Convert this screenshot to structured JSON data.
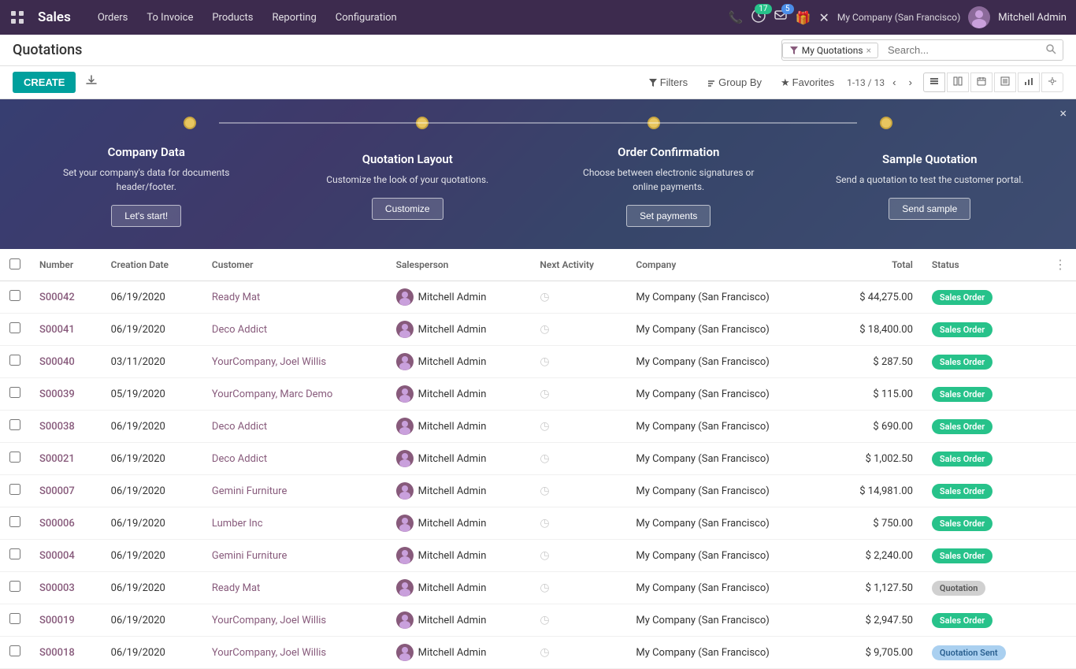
{
  "app": {
    "icon": "grid",
    "name": "Sales"
  },
  "nav": {
    "links": [
      "Orders",
      "To Invoice",
      "Products",
      "Reporting",
      "Configuration"
    ]
  },
  "topbar": {
    "phone_icon": "📞",
    "activity_badge": "17",
    "message_badge": "5",
    "gift_icon": "🎁",
    "close_icon": "✕",
    "company": "My Company (San Francisco)",
    "user_name": "Mitchell Admin"
  },
  "page": {
    "title": "Quotations",
    "search_tag": "My Quotations",
    "search_placeholder": "Search..."
  },
  "toolbar": {
    "create_label": "CREATE",
    "filters_label": "Filters",
    "group_by_label": "Group By",
    "favorites_label": "Favorites",
    "pagination": "1-13 / 13"
  },
  "banner": {
    "close": "×",
    "steps": [
      {
        "title": "Company Data",
        "description": "Set your company's data for documents header/footer.",
        "button": "Let's start!"
      },
      {
        "title": "Quotation Layout",
        "description": "Customize the look of your quotations.",
        "button": "Customize"
      },
      {
        "title": "Order Confirmation",
        "description": "Choose between electronic signatures or online payments.",
        "button": "Set payments"
      },
      {
        "title": "Sample Quotation",
        "description": "Send a quotation to test the customer portal.",
        "button": "Send sample"
      }
    ]
  },
  "table": {
    "headers": [
      "Number",
      "Creation Date",
      "Customer",
      "Salesperson",
      "Next Activity",
      "Company",
      "Total",
      "Status"
    ],
    "rows": [
      {
        "number": "S00042",
        "date": "06/19/2020",
        "customer": "Ready Mat",
        "salesperson": "Mitchell Admin",
        "activity": "",
        "company": "My Company (San Francisco)",
        "total": "$ 44,275.00",
        "status": "Sales Order",
        "status_type": "sales"
      },
      {
        "number": "S00041",
        "date": "06/19/2020",
        "customer": "Deco Addict",
        "salesperson": "Mitchell Admin",
        "activity": "",
        "company": "My Company (San Francisco)",
        "total": "$ 18,400.00",
        "status": "Sales Order",
        "status_type": "sales"
      },
      {
        "number": "S00040",
        "date": "03/11/2020",
        "customer": "YourCompany, Joel Willis",
        "salesperson": "Mitchell Admin",
        "activity": "",
        "company": "My Company (San Francisco)",
        "total": "$ 287.50",
        "status": "Sales Order",
        "status_type": "sales"
      },
      {
        "number": "S00039",
        "date": "05/19/2020",
        "customer": "YourCompany, Marc Demo",
        "salesperson": "Mitchell Admin",
        "activity": "",
        "company": "My Company (San Francisco)",
        "total": "$ 115.00",
        "status": "Sales Order",
        "status_type": "sales"
      },
      {
        "number": "S00038",
        "date": "06/19/2020",
        "customer": "Deco Addict",
        "salesperson": "Mitchell Admin",
        "activity": "",
        "company": "My Company (San Francisco)",
        "total": "$ 690.00",
        "status": "Sales Order",
        "status_type": "sales"
      },
      {
        "number": "S00021",
        "date": "06/19/2020",
        "customer": "Deco Addict",
        "salesperson": "Mitchell Admin",
        "activity": "",
        "company": "My Company (San Francisco)",
        "total": "$ 1,002.50",
        "status": "Sales Order",
        "status_type": "sales"
      },
      {
        "number": "S00007",
        "date": "06/19/2020",
        "customer": "Gemini Furniture",
        "salesperson": "Mitchell Admin",
        "activity": "",
        "company": "My Company (San Francisco)",
        "total": "$ 14,981.00",
        "status": "Sales Order",
        "status_type": "sales"
      },
      {
        "number": "S00006",
        "date": "06/19/2020",
        "customer": "Lumber Inc",
        "salesperson": "Mitchell Admin",
        "activity": "",
        "company": "My Company (San Francisco)",
        "total": "$ 750.00",
        "status": "Sales Order",
        "status_type": "sales"
      },
      {
        "number": "S00004",
        "date": "06/19/2020",
        "customer": "Gemini Furniture",
        "salesperson": "Mitchell Admin",
        "activity": "",
        "company": "My Company (San Francisco)",
        "total": "$ 2,240.00",
        "status": "Sales Order",
        "status_type": "sales"
      },
      {
        "number": "S00003",
        "date": "06/19/2020",
        "customer": "Ready Mat",
        "salesperson": "Mitchell Admin",
        "activity": "",
        "company": "My Company (San Francisco)",
        "total": "$ 1,127.50",
        "status": "Quotation",
        "status_type": "quotation"
      },
      {
        "number": "S00019",
        "date": "06/19/2020",
        "customer": "YourCompany, Joel Willis",
        "salesperson": "Mitchell Admin",
        "activity": "",
        "company": "My Company (San Francisco)",
        "total": "$ 2,947.50",
        "status": "Sales Order",
        "status_type": "sales"
      },
      {
        "number": "S00018",
        "date": "06/19/2020",
        "customer": "YourCompany, Joel Willis",
        "salesperson": "Mitchell Admin",
        "activity": "",
        "company": "My Company (San Francisco)",
        "total": "$ 9,705.00",
        "status": "Quotation Sent",
        "status_type": "sent"
      }
    ]
  }
}
